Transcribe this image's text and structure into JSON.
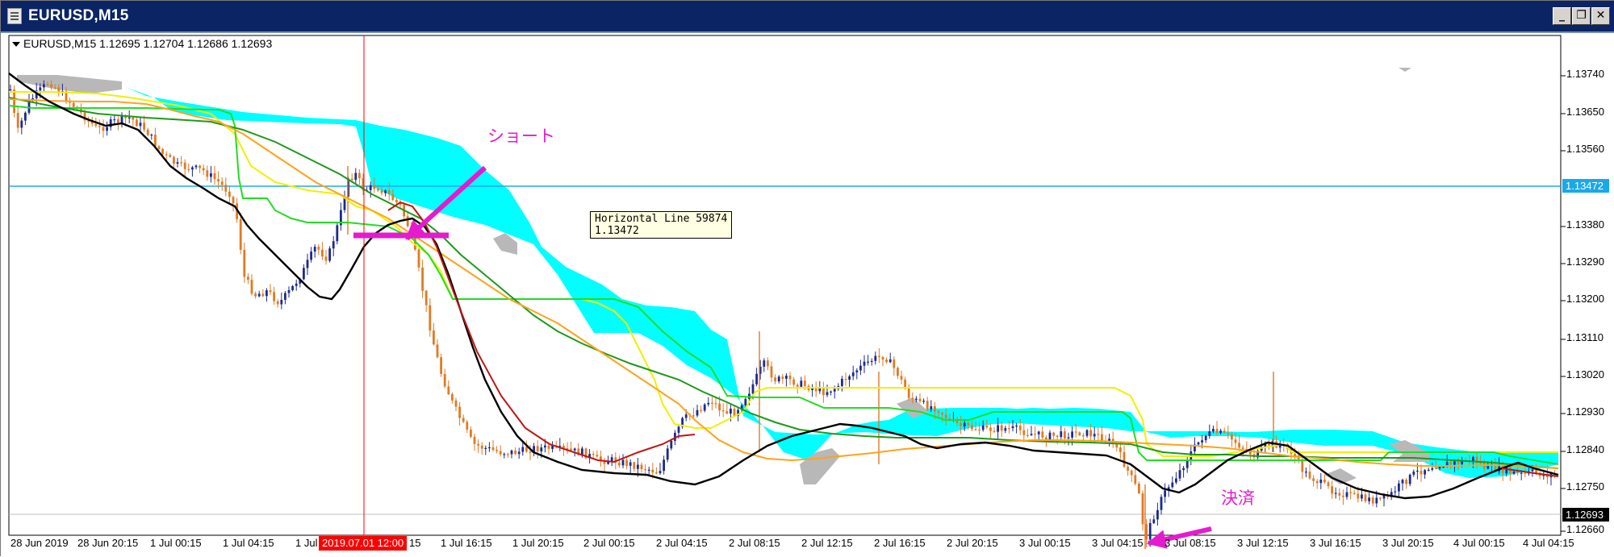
{
  "window": {
    "title": "EURUSD,M15",
    "minimize_glyph": "_",
    "restore_glyph": "❐",
    "close_glyph": "✕"
  },
  "chart": {
    "symbol_info": "EURUSD,M15  1.12695 1.12704 1.12686 1.12693",
    "y_axis_labels": [
      "1.13740",
      "1.13650",
      "1.13560",
      "1.13380",
      "1.13290",
      "1.13200",
      "1.13110",
      "1.13020",
      "1.12930",
      "1.12840",
      "1.12750",
      "1.12660"
    ],
    "horizontal_line_price": "1.13472",
    "current_price": "1.12693",
    "tooltip": "Horizontal Line 59874\n1.13472",
    "crosshair_date": "2019.07.01 12:00",
    "x_axis_labels": [
      "28 Jun 2019",
      "28 Jun 20:15",
      "1 Jul 00:15",
      "1 Jul 04:15",
      "1 Jul",
      "1 Jul 16:15",
      "1 Jul 20:15",
      "2 Jul 00:15",
      "2 Jul 04:15",
      "2 Jul 08:15",
      "2 Jul 12:15",
      "2 Jul 16:15",
      "2 Jul 20:15",
      "3 Jul 00:15",
      "3 Jul 04:15",
      "3 Jul 08:15",
      "3 Jul 12:15",
      "3 Jul 16:15",
      "3 Jul 20:15",
      "4 Jul 00:15",
      "4 Jul 04:15"
    ],
    "x_axis_label_tail": "15",
    "annotations": {
      "short": "ショート",
      "settle": "決済"
    },
    "colors": {
      "bull": "#1d2a8f",
      "bear": "#e07a24",
      "cloud": "#00ffff",
      "cloud_gray": "#b8b8b8",
      "ma_black": "#000000",
      "ma_orange": "#ffa31a",
      "ma_green": "#00e000",
      "ma_darkgreen": "#1c9a1c",
      "ma_yellow": "#f0f000",
      "ma_red": "#c01515",
      "hline": "#22aaee",
      "crosshair": "#ff0000",
      "annotation": "#e51bd0"
    }
  }
}
